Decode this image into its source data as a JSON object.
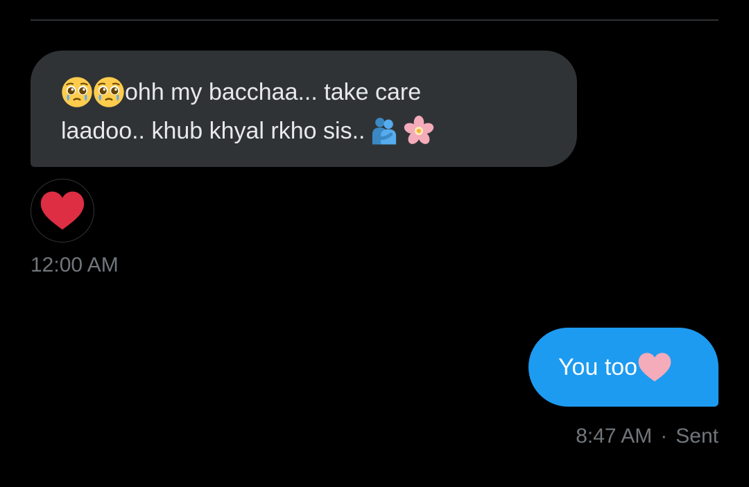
{
  "colors": {
    "background": "#000000",
    "received_bubble": "#2f3336",
    "sent_bubble": "#1d9bf0",
    "reaction_heart": "#e0294a",
    "timestamp_text": "#71767b"
  },
  "received_message": {
    "line1": "ohh my bacchaa... take care",
    "line2": "laadoo.. khub khyal rkho sis..",
    "emojis": [
      "pleading-face-emoji",
      "pleading-face-emoji",
      "people-hugging-emoji",
      "cherry-blossom-emoji"
    ],
    "reaction": "red-heart-emoji",
    "time": "12:00 AM"
  },
  "sent_message": {
    "text": "You too",
    "emoji": "pink-heart-emoji",
    "time": "8:47 AM",
    "separator": "·",
    "status": "Sent"
  }
}
